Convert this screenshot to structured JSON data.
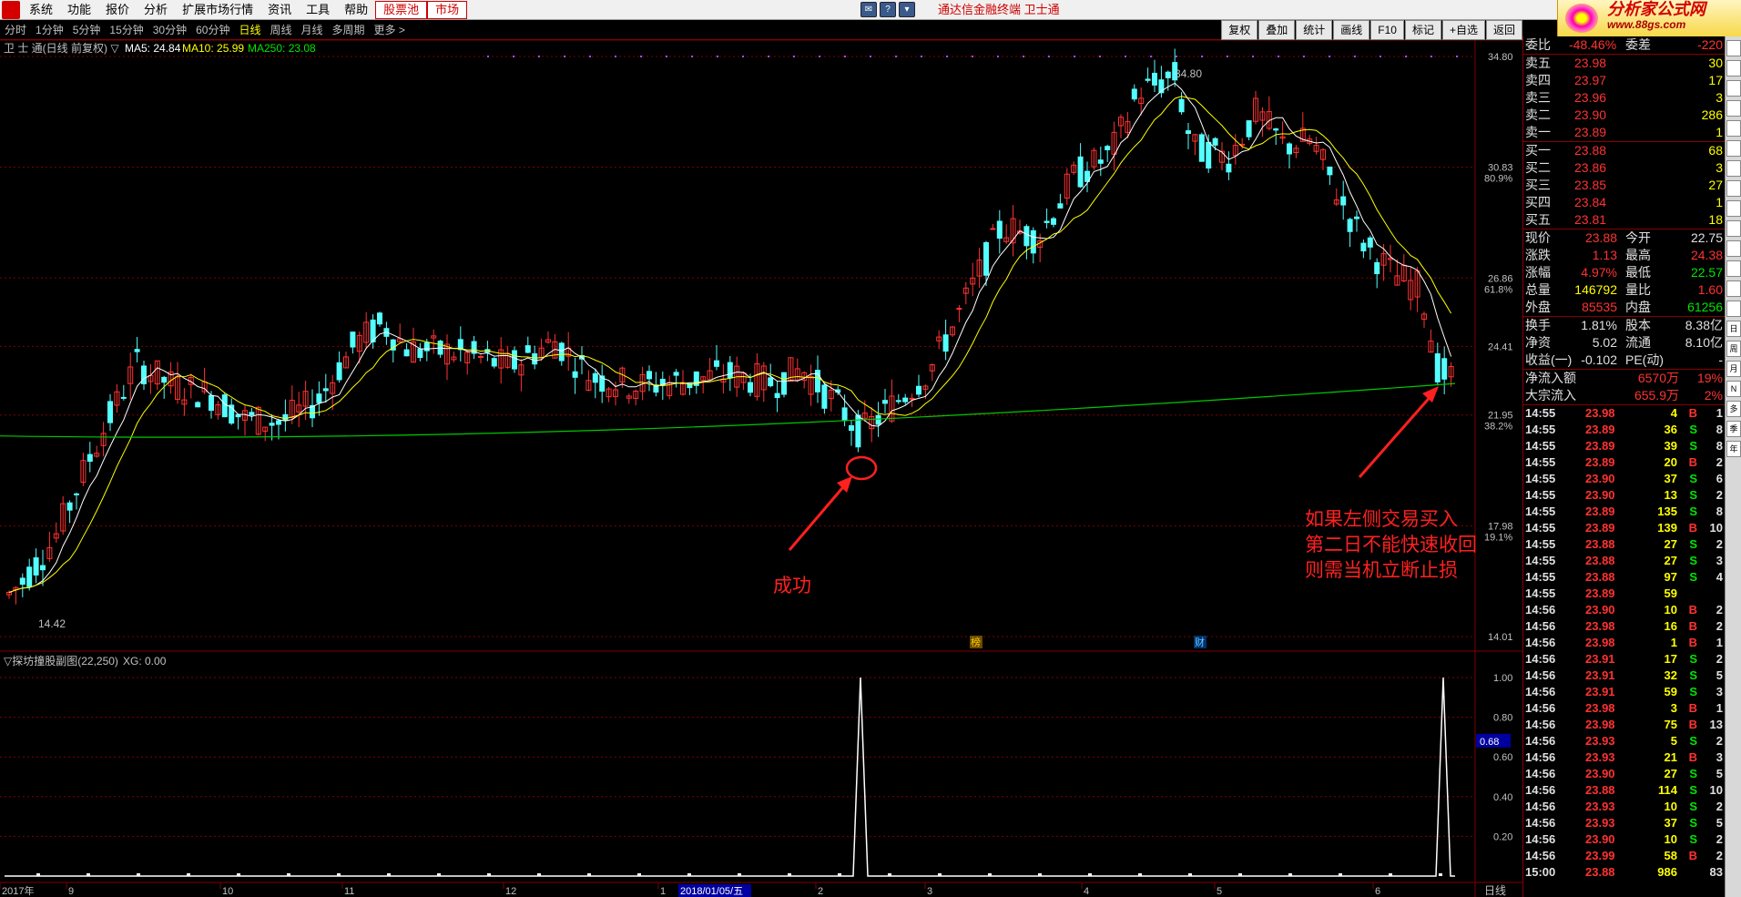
{
  "menu": {
    "items": [
      "系统",
      "功能",
      "报价",
      "分析",
      "扩展市场行情",
      "资讯",
      "工具",
      "帮助"
    ],
    "highlight": [
      "股票池",
      "市场"
    ],
    "title": "通达信金融终端  卫士通",
    "brand": "分析家公式网",
    "brand_url": "www.88gs.com"
  },
  "tabs": {
    "items": [
      "分时",
      "1分钟",
      "5分钟",
      "15分钟",
      "30分钟",
      "60分钟",
      "日线",
      "周线",
      "月线",
      "多周期",
      "更多 >"
    ],
    "active": 6,
    "right_tools": [
      "复权",
      "叠加",
      "统计",
      "画线",
      "F10",
      "标记",
      "+自选",
      "返回"
    ]
  },
  "main_header": {
    "name": "卫 士 通(日线 前复权) ▽",
    "ma5": "MA5: 24.84",
    "ma10": "MA10: 25.99",
    "ma250": "MA250: 23.08"
  },
  "sub_header": {
    "name": "▽探坊撞股副图(22,250)",
    "xg": "XG: 0.00"
  },
  "annotations": {
    "success": "成功",
    "stop": [
      "如果左侧交易买入",
      "第二日不能快速收回",
      "则需当机立断止损"
    ],
    "high_label": "34.80",
    "low_label": "14.42",
    "marker1": "榜",
    "marker2": "财"
  },
  "axis": {
    "price_ticks": [
      {
        "v": "34.80",
        "p": ""
      },
      {
        "v": "30.83",
        "p": "80.9%"
      },
      {
        "v": "26.86",
        "p": "61.8%"
      },
      {
        "v": "24.41",
        "p": ""
      },
      {
        "v": "21.95",
        "p": "38.2%"
      },
      {
        "v": "17.98",
        "p": "19.1%"
      },
      {
        "v": "14.01",
        "p": ""
      }
    ],
    "ind_ticks": [
      "1.00",
      "0.80",
      "0.60",
      "0.40",
      "0.20"
    ],
    "ind_current": "0.68",
    "date_labels": [
      "2017年",
      "9",
      "10",
      "11",
      "12",
      "1",
      "2018/01/05/五",
      "2",
      "3",
      "4",
      "5",
      "6"
    ],
    "period": "日线"
  },
  "colors": {
    "up": "#ff3232",
    "down": "#54ffff",
    "ma5": "#ffffff",
    "ma10": "#ffff00",
    "ma250": "#00c800",
    "grid": "#800000",
    "annotation": "#ff2020"
  },
  "chart_data": [
    {
      "type": "candlestick",
      "title": "卫 士 通(日线 前复权)",
      "ylim": [
        14.01,
        34.8
      ],
      "high": 34.8,
      "low": 14.42,
      "series": [
        {
          "name": "MA5",
          "values": [
            24.84
          ]
        },
        {
          "name": "MA10",
          "values": [
            25.99
          ]
        },
        {
          "name": "MA250",
          "values": [
            23.08
          ]
        }
      ]
    },
    {
      "type": "line",
      "title": "探坊撞股副图(22,250)",
      "ylim": [
        0,
        1.0
      ],
      "series": [
        {
          "name": "XG",
          "values": [
            0,
            1,
            0,
            1,
            0
          ]
        }
      ],
      "current": 0.68
    }
  ],
  "quote": {
    "weibi": {
      "label": "委比",
      "value": "-48.46%",
      "label2": "委差",
      "value2": "-220"
    },
    "asks": [
      {
        "label": "卖五",
        "price": "23.98",
        "vol": "30"
      },
      {
        "label": "卖四",
        "price": "23.97",
        "vol": "17"
      },
      {
        "label": "卖三",
        "price": "23.96",
        "vol": "3"
      },
      {
        "label": "卖二",
        "price": "23.90",
        "vol": "286"
      },
      {
        "label": "卖一",
        "price": "23.89",
        "vol": "1"
      }
    ],
    "bids": [
      {
        "label": "买一",
        "price": "23.88",
        "vol": "68"
      },
      {
        "label": "买二",
        "price": "23.86",
        "vol": "3"
      },
      {
        "label": "买三",
        "price": "23.85",
        "vol": "27"
      },
      {
        "label": "买四",
        "price": "23.84",
        "vol": "1"
      },
      {
        "label": "买五",
        "price": "23.81",
        "vol": "18"
      }
    ],
    "stats": [
      {
        "l1": "现价",
        "v1": "23.88",
        "c1": "red",
        "l2": "今开",
        "v2": "22.75",
        "c2": "white"
      },
      {
        "l1": "涨跌",
        "v1": "1.13",
        "c1": "red",
        "l2": "最高",
        "v2": "24.38",
        "c2": "red"
      },
      {
        "l1": "涨幅",
        "v1": "4.97%",
        "c1": "red",
        "l2": "最低",
        "v2": "22.57",
        "c2": "green"
      },
      {
        "l1": "总量",
        "v1": "146792",
        "c1": "yellow",
        "l2": "量比",
        "v2": "1.60",
        "c2": "red"
      },
      {
        "l1": "外盘",
        "v1": "85535",
        "c1": "red",
        "l2": "内盘",
        "v2": "61256",
        "c2": "green"
      }
    ],
    "stats2": [
      {
        "l1": "换手",
        "v1": "1.81%",
        "c1": "white",
        "l2": "股本",
        "v2": "8.38亿",
        "c2": "white"
      },
      {
        "l1": "净资",
        "v1": "5.02",
        "c1": "white",
        "l2": "流通",
        "v2": "8.10亿",
        "c2": "white"
      },
      {
        "l1": "收益(一)",
        "v1": "-0.102",
        "c1": "white",
        "l2": "PE(动)",
        "v2": "-",
        "c2": "white"
      }
    ],
    "flows": [
      {
        "label": "净流入额",
        "value": "6570万",
        "pct": "19%"
      },
      {
        "label": "大宗流入",
        "value": "655.9万",
        "pct": "2%"
      }
    ]
  },
  "ticks": [
    {
      "t": "14:55",
      "p": "23.98",
      "pc": "red",
      "v": "4",
      "d": "B",
      "n": "1"
    },
    {
      "t": "14:55",
      "p": "23.89",
      "pc": "red",
      "v": "36",
      "d": "S",
      "n": "8"
    },
    {
      "t": "14:55",
      "p": "23.89",
      "pc": "red",
      "v": "39",
      "d": "S",
      "n": "8"
    },
    {
      "t": "14:55",
      "p": "23.89",
      "pc": "red",
      "v": "20",
      "d": "B",
      "n": "2"
    },
    {
      "t": "14:55",
      "p": "23.90",
      "pc": "red",
      "v": "37",
      "d": "S",
      "n": "6"
    },
    {
      "t": "14:55",
      "p": "23.90",
      "pc": "red",
      "v": "13",
      "d": "S",
      "n": "2"
    },
    {
      "t": "14:55",
      "p": "23.89",
      "pc": "red",
      "v": "135",
      "d": "S",
      "n": "8"
    },
    {
      "t": "14:55",
      "p": "23.89",
      "pc": "red",
      "v": "139",
      "d": "B",
      "n": "10"
    },
    {
      "t": "14:55",
      "p": "23.88",
      "pc": "red",
      "v": "27",
      "d": "S",
      "n": "2"
    },
    {
      "t": "14:55",
      "p": "23.88",
      "pc": "red",
      "v": "27",
      "d": "S",
      "n": "3"
    },
    {
      "t": "14:55",
      "p": "23.88",
      "pc": "red",
      "v": "97",
      "d": "S",
      "n": "4"
    },
    {
      "t": "14:55",
      "p": "23.89",
      "pc": "red",
      "v": "59",
      "d": "",
      "n": ""
    },
    {
      "t": "14:56",
      "p": "23.90",
      "pc": "red",
      "v": "10",
      "d": "B",
      "n": "2"
    },
    {
      "t": "14:56",
      "p": "23.98",
      "pc": "red",
      "v": "16",
      "d": "B",
      "n": "2"
    },
    {
      "t": "14:56",
      "p": "23.98",
      "pc": "red",
      "v": "1",
      "d": "B",
      "n": "1"
    },
    {
      "t": "14:56",
      "p": "23.91",
      "pc": "red",
      "v": "17",
      "d": "S",
      "n": "2"
    },
    {
      "t": "14:56",
      "p": "23.91",
      "pc": "red",
      "v": "32",
      "d": "S",
      "n": "5"
    },
    {
      "t": "14:56",
      "p": "23.91",
      "pc": "red",
      "v": "59",
      "d": "S",
      "n": "3"
    },
    {
      "t": "14:56",
      "p": "23.98",
      "pc": "red",
      "v": "3",
      "d": "B",
      "n": "1"
    },
    {
      "t": "14:56",
      "p": "23.98",
      "pc": "red",
      "v": "75",
      "d": "B",
      "n": "13"
    },
    {
      "t": "14:56",
      "p": "23.93",
      "pc": "red",
      "v": "5",
      "d": "S",
      "n": "2"
    },
    {
      "t": "14:56",
      "p": "23.93",
      "pc": "red",
      "v": "21",
      "d": "B",
      "n": "3"
    },
    {
      "t": "14:56",
      "p": "23.90",
      "pc": "red",
      "v": "27",
      "d": "S",
      "n": "5"
    },
    {
      "t": "14:56",
      "p": "23.88",
      "pc": "red",
      "v": "114",
      "d": "S",
      "n": "10"
    },
    {
      "t": "14:56",
      "p": "23.93",
      "pc": "red",
      "v": "10",
      "d": "S",
      "n": "2"
    },
    {
      "t": "14:56",
      "p": "23.93",
      "pc": "red",
      "v": "37",
      "d": "S",
      "n": "5"
    },
    {
      "t": "14:56",
      "p": "23.90",
      "pc": "red",
      "v": "10",
      "d": "S",
      "n": "2"
    },
    {
      "t": "14:56",
      "p": "23.99",
      "pc": "red",
      "v": "58",
      "d": "B",
      "n": "2"
    },
    {
      "t": "15:00",
      "p": "23.88",
      "pc": "red",
      "v": "986",
      "d": "",
      "n": "83"
    }
  ],
  "sidebar": [
    "日",
    "周",
    "月",
    "N",
    "多",
    "季",
    "年"
  ]
}
